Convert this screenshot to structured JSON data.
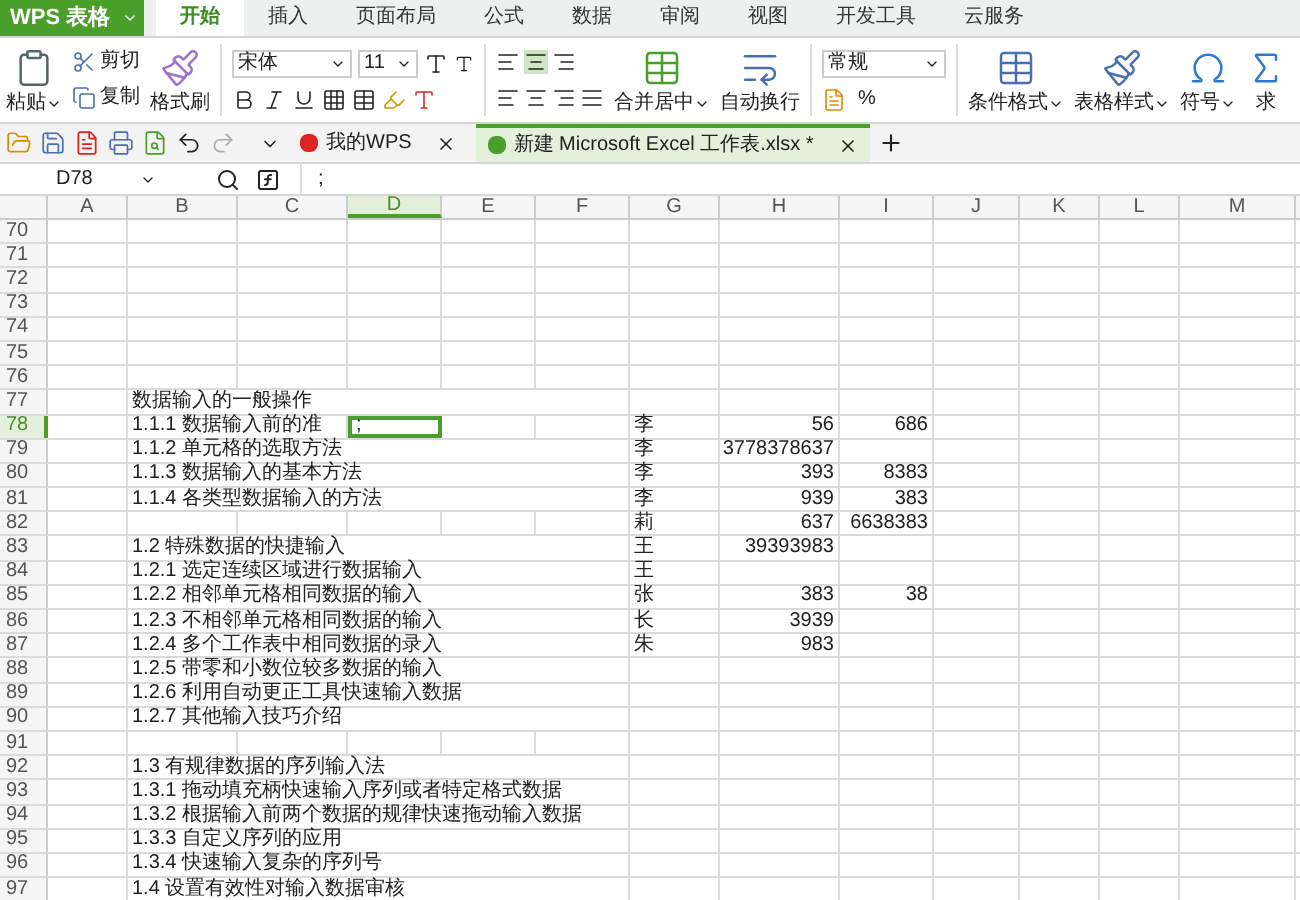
{
  "app_button": "WPS 表格",
  "tabs": [
    {
      "label": "开始",
      "selected": true
    },
    {
      "label": "插入",
      "selected": false
    },
    {
      "label": "页面布局",
      "selected": false
    },
    {
      "label": "公式",
      "selected": false
    },
    {
      "label": "数据",
      "selected": false
    },
    {
      "label": "审阅",
      "selected": false
    },
    {
      "label": "视图",
      "selected": false
    },
    {
      "label": "开发工具",
      "selected": false
    },
    {
      "label": "云服务",
      "selected": false
    }
  ],
  "ribbon": {
    "paste": "粘贴",
    "cut": "剪切",
    "copy": "复制",
    "format_painter": "格式刷",
    "font": "宋体",
    "font_size": "11",
    "merge": "合并居中",
    "wrap": "自动换行",
    "number_format": "常规",
    "percent": "%",
    "conditional": "条件格式",
    "table_style": "表格样式",
    "symbol": "符号",
    "sum": "求"
  },
  "doc_tabs": [
    {
      "label": "我的WPS",
      "selected": false
    },
    {
      "label": "新建 Microsoft Excel 工作表.xlsx *",
      "selected": true
    }
  ],
  "name_box": "D78",
  "formula": ";",
  "columns": [
    {
      "label": "A",
      "selected": false
    },
    {
      "label": "B",
      "selected": false
    },
    {
      "label": "C",
      "selected": false
    },
    {
      "label": "D",
      "selected": true
    },
    {
      "label": "E",
      "selected": false
    },
    {
      "label": "F",
      "selected": false
    },
    {
      "label": "G",
      "selected": false
    },
    {
      "label": "H",
      "selected": false
    },
    {
      "label": "I",
      "selected": false
    },
    {
      "label": "J",
      "selected": false
    },
    {
      "label": "K",
      "selected": false
    },
    {
      "label": "L",
      "selected": false
    },
    {
      "label": "M",
      "selected": false
    }
  ],
  "rows": [
    {
      "number": "70",
      "selected": false
    },
    {
      "number": "71",
      "selected": false
    },
    {
      "number": "72",
      "selected": false
    },
    {
      "number": "73",
      "selected": false
    },
    {
      "number": "74",
      "selected": false
    },
    {
      "number": "75",
      "selected": false
    },
    {
      "number": "76",
      "selected": false
    },
    {
      "number": "77",
      "selected": false,
      "b": "数据输入的一般操作"
    },
    {
      "number": "78",
      "selected": true,
      "b": "1.1.1 数据输入前的准",
      "d": ";",
      "g": "李",
      "h": "56",
      "i": "686"
    },
    {
      "number": "79",
      "selected": false,
      "b": "1.1.2 单元格的选取方法",
      "g": "李",
      "h": "3778378637"
    },
    {
      "number": "80",
      "selected": false,
      "b": "1.1.3 数据输入的基本方法",
      "g": "李",
      "h": "393",
      "i": "8383"
    },
    {
      "number": "81",
      "selected": false,
      "b": "1.1.4 各类型数据输入的方法",
      "g": "李",
      "h": "939",
      "i": "383"
    },
    {
      "number": "82",
      "selected": false,
      "g": "莉",
      "h": "637",
      "i": "6638383"
    },
    {
      "number": "83",
      "selected": false,
      "b": "1.2 特殊数据的快捷输入",
      "g": "王",
      "h": "39393983"
    },
    {
      "number": "84",
      "selected": false,
      "b": "1.2.1 选定连续区域进行数据输入",
      "g": "王"
    },
    {
      "number": "85",
      "selected": false,
      "b": "1.2.2 相邻单元格相同数据的输入",
      "g": "张",
      "h": "383",
      "i": "38"
    },
    {
      "number": "86",
      "selected": false,
      "b": "1.2.3 不相邻单元格相同数据的输入",
      "g": "长",
      "h": "3939"
    },
    {
      "number": "87",
      "selected": false,
      "b": "1.2.4 多个工作表中相同数据的录入",
      "g": "朱",
      "h": "983"
    },
    {
      "number": "88",
      "selected": false,
      "b": "1.2.5 带零和小数位较多数据的输入"
    },
    {
      "number": "89",
      "selected": false,
      "b": "1.2.6 利用自动更正工具快速输入数据"
    },
    {
      "number": "90",
      "selected": false,
      "b": "1.2.7 其他输入技巧介绍"
    },
    {
      "number": "91",
      "selected": false
    },
    {
      "number": "92",
      "selected": false,
      "b": "1.3 有规律数据的序列输入法"
    },
    {
      "number": "93",
      "selected": false,
      "b": "1.3.1 拖动填充柄快速输入序列或者特定格式数据"
    },
    {
      "number": "94",
      "selected": false,
      "b": "1.3.2 根据输入前两个数据的规律快速拖动输入数据"
    },
    {
      "number": "95",
      "selected": false,
      "b": "1.3.3 自定义序列的应用"
    },
    {
      "number": "96",
      "selected": false,
      "b": "1.3.4 快速输入复杂的序列号"
    },
    {
      "number": "97",
      "selected": false,
      "b": "1.4 设置有效性对输入数据审核"
    }
  ]
}
